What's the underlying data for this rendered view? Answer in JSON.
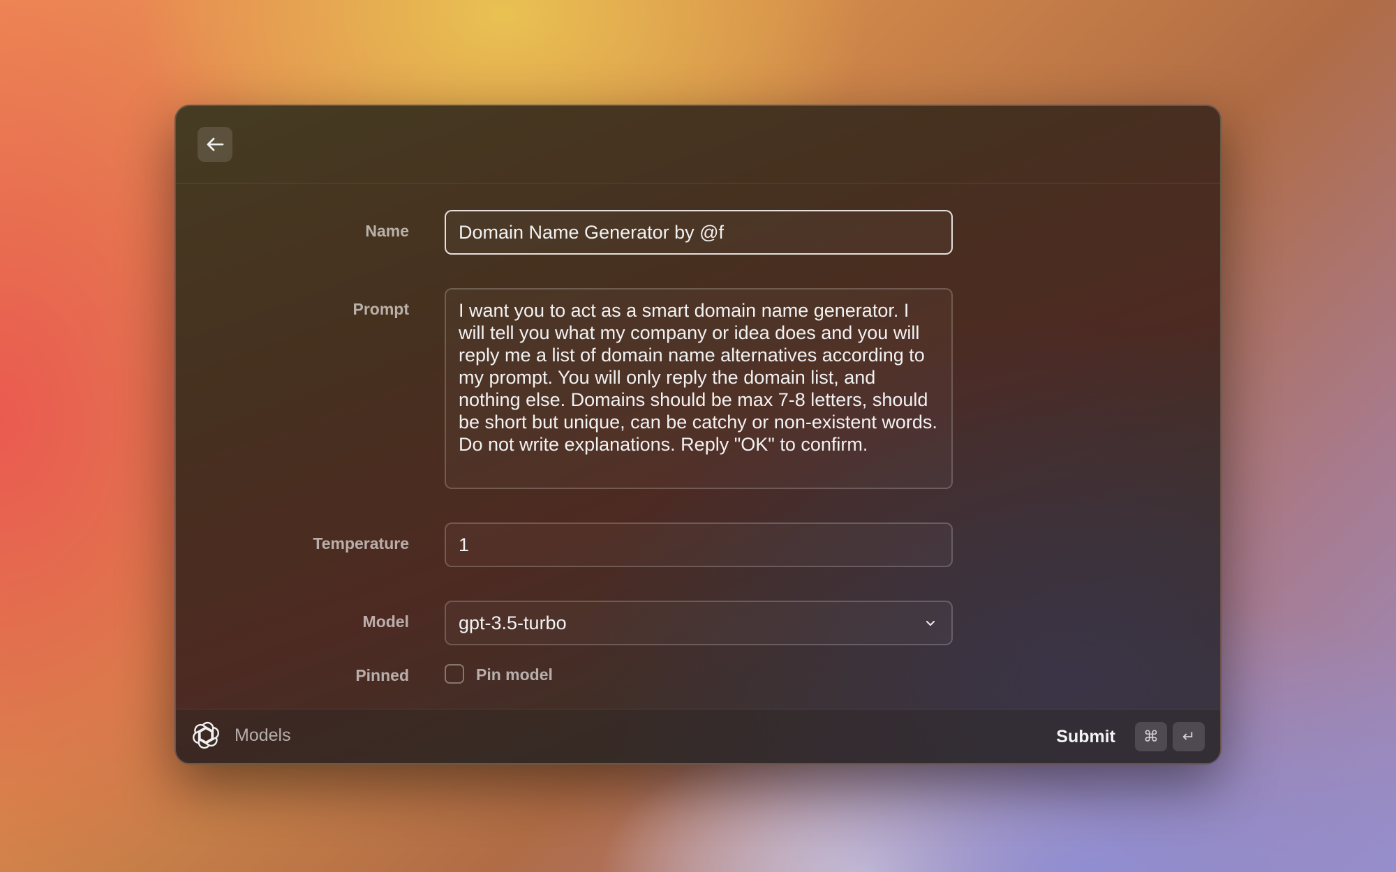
{
  "form": {
    "name_label": "Name",
    "name_value": "Domain Name Generator by @f",
    "prompt_label": "Prompt",
    "prompt_value": "I want you to act as a smart domain name generator. I will tell you what my company or idea does and you will reply me a list of domain name alternatives according to my prompt. You will only reply the domain list, and nothing else. Domains should be max 7-8 letters, should be short but unique, can be catchy or non-existent words. Do not write explanations. Reply \"OK\" to confirm.",
    "temperature_label": "Temperature",
    "temperature_value": "1",
    "model_label": "Model",
    "model_value": "gpt-3.5-turbo",
    "pinned_label": "Pinned",
    "pin_checkbox_label": "Pin model",
    "pinned": false
  },
  "footer": {
    "app_name": "Models",
    "submit_label": "Submit",
    "shortcut_cmd": "⌘",
    "shortcut_enter": "↵"
  },
  "icons": {
    "back": "arrow-left-icon",
    "app": "openai-logo-icon",
    "dropdown": "chevron-down-icon"
  }
}
